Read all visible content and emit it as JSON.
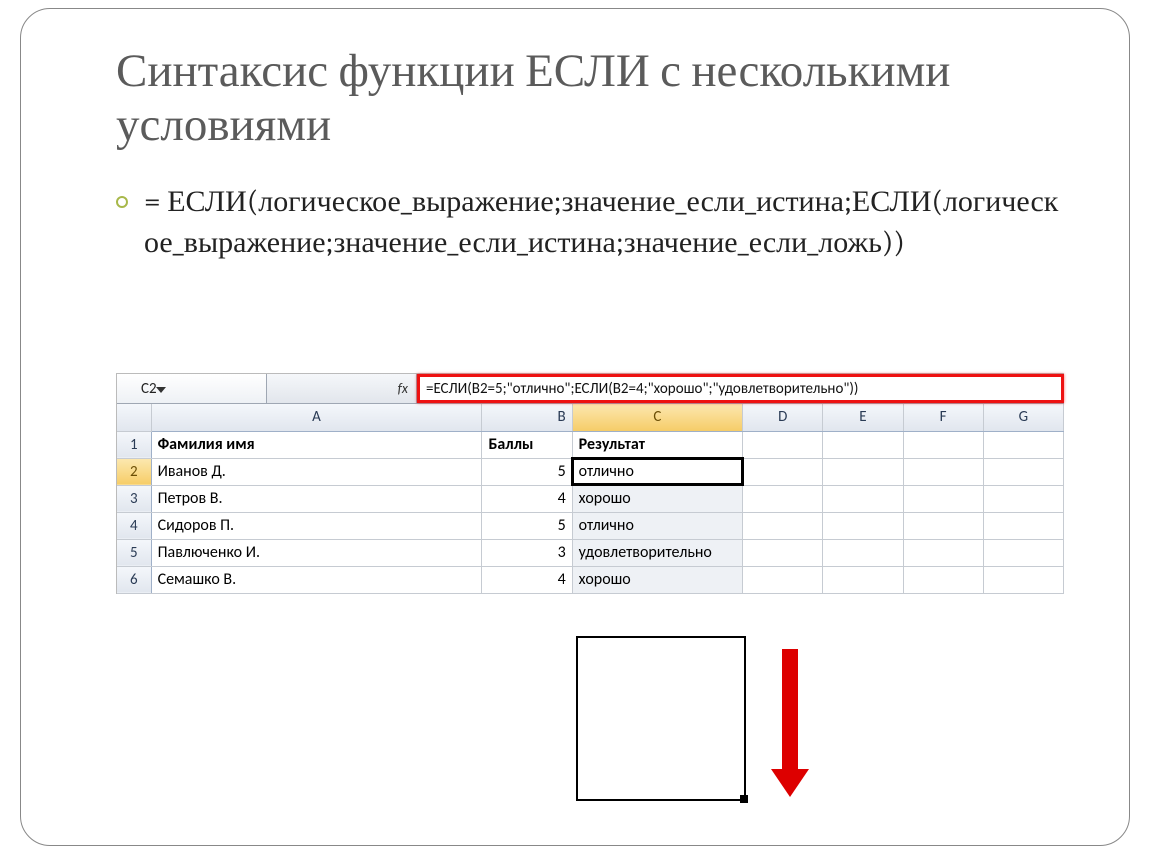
{
  "title": "Синтаксис функции ЕСЛИ с несколькими условиями",
  "bullet": "= ЕСЛИ(логическое_выражение;значение_если_истина;ЕСЛИ(логическое_выражение;значение_если_истина;значение_если_ложь))",
  "excel": {
    "namebox": "C2",
    "fx_label": "fx",
    "formula": "=ЕСЛИ(B2=5;\"отлично\";ЕСЛИ(B2=4;\"хорошо\";\"удовлетворительно\"))",
    "columns": [
      "A",
      "B",
      "C",
      "D",
      "E",
      "F",
      "G"
    ],
    "header_row": {
      "A": "Фамилия имя",
      "B": "Баллы",
      "C": "Результат"
    },
    "rows": [
      {
        "n": "2",
        "A": "Иванов Д.",
        "B": "5",
        "C": "отлично"
      },
      {
        "n": "3",
        "A": "Петров В.",
        "B": "4",
        "C": "хорошо"
      },
      {
        "n": "4",
        "A": "Сидоров П.",
        "B": "5",
        "C": "отлично"
      },
      {
        "n": "5",
        "A": "Павлюченко И.",
        "B": "3",
        "C": "удовлетворительно"
      },
      {
        "n": "6",
        "A": "Семашко В.",
        "B": "4",
        "C": "хорошо"
      }
    ]
  }
}
